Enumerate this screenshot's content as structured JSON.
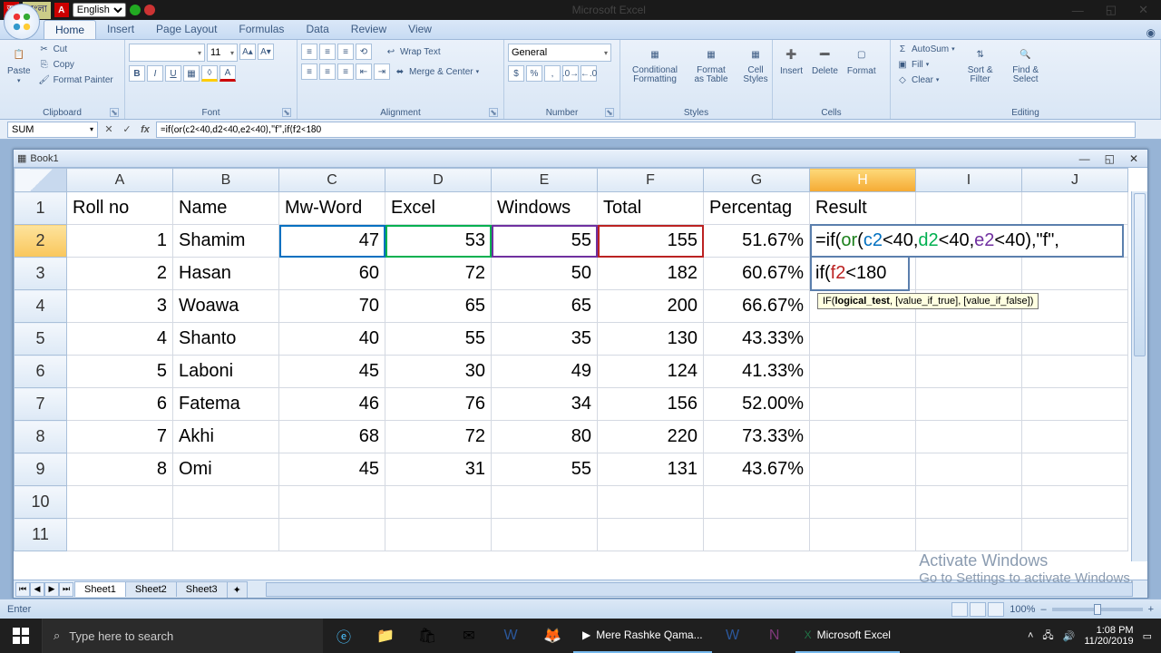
{
  "app": {
    "title": "Microsoft Excel",
    "workbook": "Book1"
  },
  "lang": {
    "b1": "অ",
    "b2": "বাংলা",
    "b3": "A",
    "sel": "English"
  },
  "tabs": [
    "Home",
    "Insert",
    "Page Layout",
    "Formulas",
    "Data",
    "Review",
    "View"
  ],
  "clipboard": {
    "paste": "Paste",
    "cut": "Cut",
    "copy": "Copy",
    "fp": "Format Painter",
    "label": "Clipboard"
  },
  "font": {
    "size": "11",
    "label": "Font"
  },
  "align": {
    "wrap": "Wrap Text",
    "merge": "Merge & Center",
    "label": "Alignment"
  },
  "number": {
    "fmt": "General",
    "label": "Number"
  },
  "styles": {
    "cf": "Conditional Formatting",
    "fat": "Format as Table",
    "cs": "Cell Styles",
    "label": "Styles"
  },
  "cells": {
    "ins": "Insert",
    "del": "Delete",
    "fmt": "Format",
    "label": "Cells"
  },
  "editing": {
    "sum": "AutoSum",
    "fill": "Fill",
    "clear": "Clear",
    "sort": "Sort & Filter",
    "find": "Find & Select",
    "label": "Editing"
  },
  "fbar": {
    "name": "SUM",
    "formula": "=if(or(c2<40,d2<40,e2<40),\"f\",if(f2<180"
  },
  "cols": [
    "A",
    "B",
    "C",
    "D",
    "E",
    "F",
    "G",
    "H",
    "I",
    "J"
  ],
  "headers": {
    "A": "Roll no",
    "B": "Name",
    "C": "Mw-Word",
    "D": "Excel",
    "E": "Windows",
    "F": "Total",
    "G": "Percentag",
    "H": "Result"
  },
  "rows": [
    {
      "n": "1",
      "A": "1",
      "B": "Shamim",
      "C": "47",
      "D": "53",
      "E": "55",
      "F": "155",
      "G": "51.67%"
    },
    {
      "n": "2",
      "A": "2",
      "B": "Hasan",
      "C": "60",
      "D": "72",
      "E": "50",
      "F": "182",
      "G": "60.67%"
    },
    {
      "n": "3",
      "A": "3",
      "B": "Woawa",
      "C": "70",
      "D": "65",
      "E": "65",
      "F": "200",
      "G": "66.67%"
    },
    {
      "n": "4",
      "A": "4",
      "B": "Shanto",
      "C": "40",
      "D": "55",
      "E": "35",
      "F": "130",
      "G": "43.33%"
    },
    {
      "n": "5",
      "A": "5",
      "B": "Laboni",
      "C": "45",
      "D": "30",
      "E": "49",
      "F": "124",
      "G": "41.33%"
    },
    {
      "n": "6",
      "A": "6",
      "B": "Fatema",
      "C": "46",
      "D": "76",
      "E": "34",
      "F": "156",
      "G": "52.00%"
    },
    {
      "n": "7",
      "A": "7",
      "B": "Akhi",
      "C": "68",
      "D": "72",
      "E": "80",
      "F": "220",
      "G": "73.33%"
    },
    {
      "n": "8",
      "A": "8",
      "B": "Omi",
      "C": "45",
      "D": "31",
      "E": "55",
      "F": "131",
      "G": "43.67%"
    }
  ],
  "edit": {
    "line1_pre": "=if(",
    "or": "or",
    "l1a": "(",
    "c2": "c2",
    "l1b": "<40,",
    "d2": "d2",
    "l1c": "<40,",
    "e2": "e2",
    "l1d": "<40),\"f\",",
    "line2_pre": "if(",
    "f2": "f2",
    "l2a": "<180",
    "tooltip": "IF(",
    "tt_b": "logical_test",
    "tt_r": ", [value_if_true], [value_if_false])"
  },
  "sheets": [
    "Sheet1",
    "Sheet2",
    "Sheet3"
  ],
  "status": {
    "mode": "Enter",
    "zoom": "100%"
  },
  "taskbar": {
    "search": "Type here to search",
    "task": "Mere Rashke Qama...",
    "excel": "Microsoft Excel",
    "time": "1:08 PM",
    "date": "11/20/2019"
  },
  "watermark": {
    "t": "Activate Windows",
    "s": "Go to Settings to activate Windows."
  }
}
